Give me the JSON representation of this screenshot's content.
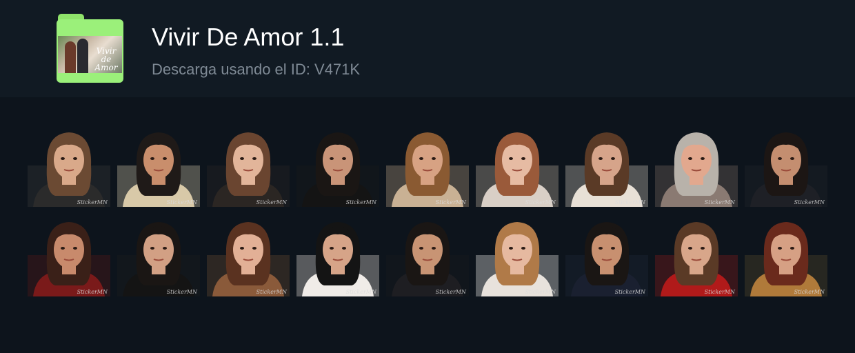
{
  "pack": {
    "title": "Vivir De Amor 1.1",
    "subtitle": "Descarga usando el ID: V471K",
    "cover_text": "Vivir de Amor",
    "icon": "folder-icon"
  },
  "stickers": [
    {
      "hair": "#6b4a33",
      "skin": "#d9a98a",
      "cloth": "#2b2b2b",
      "bg": "#3a3a3a",
      "wm": "StickerMN"
    },
    {
      "hair": "#1f1a18",
      "skin": "#c98e6c",
      "cloth": "#d8c9a8",
      "bg": "#cfc2a6",
      "wm": "StickerMN"
    },
    {
      "hair": "#6a4530",
      "skin": "#e2b59a",
      "cloth": "#2b2623",
      "bg": "#2a2624",
      "wm": "StickerMN"
    },
    {
      "hair": "#1a1614",
      "skin": "#c99478",
      "cloth": "#141414",
      "bg": "#1a1a1a",
      "wm": "StickerMN"
    },
    {
      "hair": "#8a5a32",
      "skin": "#d7a283",
      "cloth": "#c9b194",
      "bg": "#b79e80",
      "wm": "StickerMN"
    },
    {
      "hair": "#9a5a3a",
      "skin": "#e6bba3",
      "cloth": "#d9cfc6",
      "bg": "#bcae9e",
      "wm": "StickerMN"
    },
    {
      "hair": "#5a3a26",
      "skin": "#d6a48a",
      "cloth": "#e8e0d6",
      "bg": "#cfc6ba",
      "wm": "StickerMN"
    },
    {
      "hair": "#b8b2aa",
      "skin": "#e2a88e",
      "cloth": "#8a7a72",
      "bg": "#7a6a62",
      "wm": "StickerMN"
    },
    {
      "hair": "#1c1614",
      "skin": "#c48e70",
      "cloth": "#1e2026",
      "bg": "#23262c",
      "wm": "StickerMN"
    },
    {
      "hair": "#3a2018",
      "skin": "#c88a6c",
      "cloth": "#7a1a1a",
      "bg": "#5a1616",
      "wm": "StickerMN"
    },
    {
      "hair": "#1a1614",
      "skin": "#d2a084",
      "cloth": "#141414",
      "bg": "#1c1c1c",
      "wm": "StickerMN"
    },
    {
      "hair": "#5a3220",
      "skin": "#e2b096",
      "cloth": "#8a5a3a",
      "bg": "#6a4a32",
      "wm": "StickerMN"
    },
    {
      "hair": "#141414",
      "skin": "#d6a488",
      "cloth": "#f0ece8",
      "bg": "#e6dcd6",
      "wm": "StickerMN"
    },
    {
      "hair": "#1a1614",
      "skin": "#c89474",
      "cloth": "#1e1e22",
      "bg": "#1a1a1e",
      "wm": "StickerMN"
    },
    {
      "hair": "#b07a48",
      "skin": "#e6b9a0",
      "cloth": "#e8e2dc",
      "bg": "#f2eeea",
      "wm": "StickerMN"
    },
    {
      "hair": "#1a1614",
      "skin": "#c89070",
      "cloth": "#1a2030",
      "bg": "#20283a",
      "wm": "StickerMN"
    },
    {
      "hair": "#5a3a26",
      "skin": "#d8a68a",
      "cloth": "#b01a1a",
      "bg": "#8a1a1a",
      "wm": "StickerMN"
    },
    {
      "hair": "#6a2a1c",
      "skin": "#d6a084",
      "cloth": "#b07a3a",
      "bg": "#5a4a2a",
      "wm": "StickerMN"
    }
  ]
}
